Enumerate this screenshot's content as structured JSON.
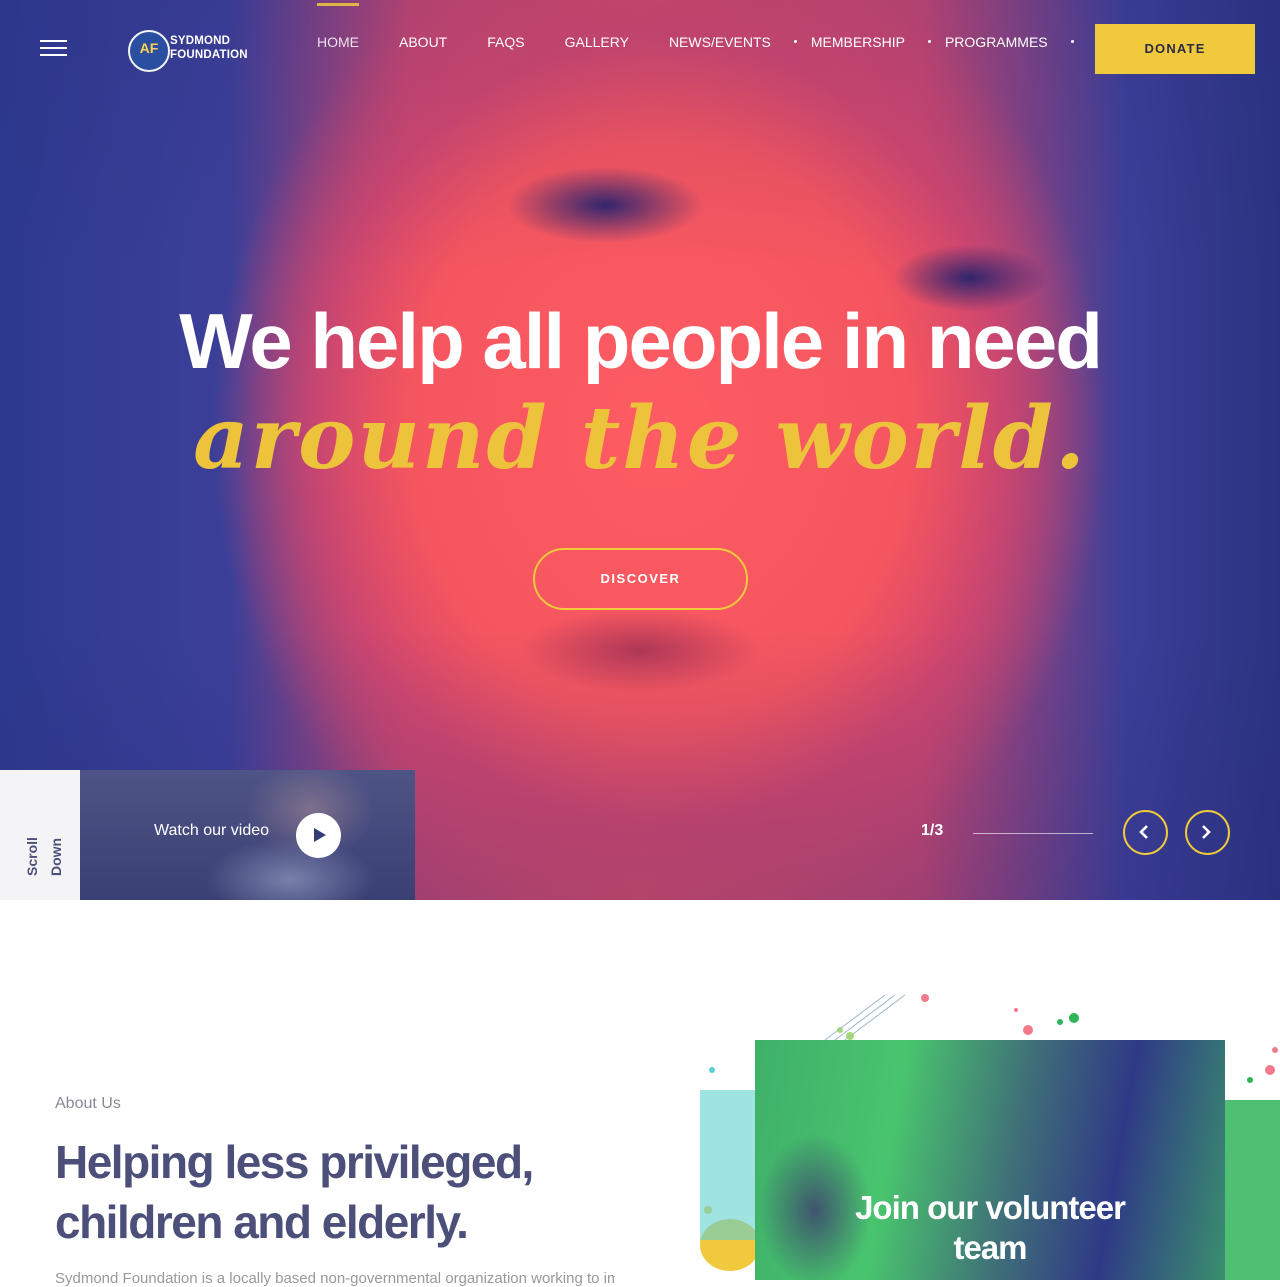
{
  "header": {
    "logo_text_line1": "SYDMOND",
    "logo_text_line2": "FOUNDATION",
    "logo_mark": "AF",
    "nav": [
      {
        "label": "HOME",
        "active": true
      },
      {
        "label": "ABOUT"
      },
      {
        "label": "FAQS"
      },
      {
        "label": "GALLERY"
      },
      {
        "label": "NEWS/EVENTS",
        "has_dropdown": true
      },
      {
        "label": "MEMBERSHIP",
        "has_dropdown": true
      },
      {
        "label": "PROGRAMMES",
        "has_dropdown": true
      }
    ],
    "donate_label": "DONATE"
  },
  "hero": {
    "headline": "We help all people in need",
    "script": "around the world.",
    "cta_label": "DISCOVER",
    "scroll_label_1": "Scroll",
    "scroll_label_2": "Down",
    "video_label": "Watch our video",
    "slide_counter": "1/3"
  },
  "about": {
    "kicker": "About Us",
    "title_line1": "Helping less privileged,",
    "title_line2": "children and elderly.",
    "body": "Sydmond Foundation is a locally based non-governmental organization working to improve lives",
    "volunteer_line1": "Join our volunteer",
    "volunteer_line2": "team"
  },
  "colors": {
    "accent": "#f0c93c",
    "heading": "#4b4f7a"
  },
  "icons": [
    "menu-icon",
    "play-icon",
    "chevron-left-icon",
    "chevron-right-icon"
  ]
}
